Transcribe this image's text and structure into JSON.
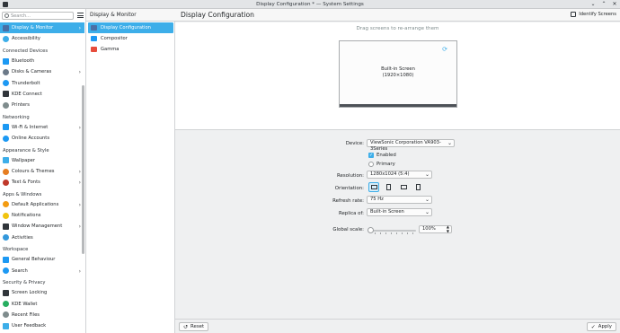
{
  "window": {
    "title": "Display Configuration * — System Settings"
  },
  "sidebar": {
    "search_placeholder": "Search...",
    "items": [
      {
        "type": "item",
        "label": "Display & Monitor",
        "icon": "monitor-icon",
        "color": "#4a6fa5",
        "active": true,
        "chevron": true
      },
      {
        "type": "item",
        "label": "Accessibility",
        "icon": "accessibility-icon",
        "color": "#3daee9"
      },
      {
        "type": "section",
        "label": "Connected Devices"
      },
      {
        "type": "item",
        "label": "Bluetooth",
        "icon": "bluetooth-icon",
        "color": "#1d99f3"
      },
      {
        "type": "item",
        "label": "Disks & Cameras",
        "icon": "disk-icon",
        "color": "#6c7a89",
        "chevron": true
      },
      {
        "type": "item",
        "label": "Thunderbolt",
        "icon": "thunderbolt-icon",
        "color": "#1d99f3"
      },
      {
        "type": "item",
        "label": "KDE Connect",
        "icon": "kde-connect-icon",
        "color": "#31363b"
      },
      {
        "type": "item",
        "label": "Printers",
        "icon": "printer-icon",
        "color": "#7f8c8d"
      },
      {
        "type": "section",
        "label": "Networking"
      },
      {
        "type": "item",
        "label": "Wi-Fi & Internet",
        "icon": "network-icon",
        "color": "#1d99f3",
        "chevron": true
      },
      {
        "type": "item",
        "label": "Online Accounts",
        "icon": "online-accounts-icon",
        "color": "#1d99f3"
      },
      {
        "type": "section",
        "label": "Appearance & Style"
      },
      {
        "type": "item",
        "label": "Wallpaper",
        "icon": "wallpaper-icon",
        "color": "#3daee9"
      },
      {
        "type": "item",
        "label": "Colours & Themes",
        "icon": "colours-icon",
        "color": "#e67e22",
        "chevron": true
      },
      {
        "type": "item",
        "label": "Text & Fonts",
        "icon": "font-icon",
        "color": "#c0392b",
        "chevron": true
      },
      {
        "type": "section",
        "label": "Apps & Windows"
      },
      {
        "type": "item",
        "label": "Default Applications",
        "icon": "default-apps-icon",
        "color": "#f39c12",
        "chevron": true
      },
      {
        "type": "item",
        "label": "Notifications",
        "icon": "bell-icon",
        "color": "#f1c40f"
      },
      {
        "type": "item",
        "label": "Window Management",
        "icon": "window-icon",
        "color": "#31363b",
        "chevron": true
      },
      {
        "type": "item",
        "label": "Activities",
        "icon": "activities-icon",
        "color": "#3498db"
      },
      {
        "type": "section",
        "label": "Workspace"
      },
      {
        "type": "item",
        "label": "General Behaviour",
        "icon": "general-behaviour-icon",
        "color": "#1d99f3"
      },
      {
        "type": "item",
        "label": "Search",
        "icon": "search-icon",
        "color": "#1d99f3",
        "chevron": true
      },
      {
        "type": "section",
        "label": "Security & Privacy"
      },
      {
        "type": "item",
        "label": "Screen Locking",
        "icon": "lock-icon",
        "color": "#31363b"
      },
      {
        "type": "item",
        "label": "KDE Wallet",
        "icon": "wallet-icon",
        "color": "#27ae60"
      },
      {
        "type": "item",
        "label": "Recent Files",
        "icon": "recent-files-icon",
        "color": "#7f8c8d"
      },
      {
        "type": "item",
        "label": "User Feedback",
        "icon": "feedback-icon",
        "color": "#3daee9"
      }
    ]
  },
  "subcategory": {
    "title": "Display & Monitor",
    "items": [
      {
        "label": "Display Configuration",
        "icon": "display-config-icon",
        "color": "#4a6fa5",
        "active": true
      },
      {
        "label": "Compositor",
        "icon": "compositor-icon",
        "color": "#1d99f3"
      },
      {
        "label": "Gamma",
        "icon": "gamma-icon",
        "color": "#e74c3c"
      }
    ]
  },
  "main": {
    "title": "Display Configuration",
    "identify_label": "Identify Screens",
    "arrange_hint": "Drag screens to re-arrange them",
    "screen": {
      "name": "Built-in Screen",
      "resolution": "(1920×1080)"
    },
    "device": {
      "label": "Device:",
      "value": "ViewSonic Corporation VA903-3Series"
    },
    "enabled": {
      "label": "Enabled",
      "checked": true
    },
    "primary": {
      "label": "Primary",
      "checked": false
    },
    "resolution": {
      "label": "Resolution:",
      "value": "1280x1024 (5:4)"
    },
    "orientation": {
      "label": "Orientation:",
      "selected": "landscape"
    },
    "refresh": {
      "label": "Refresh rate:",
      "value": "75 Hz"
    },
    "replica": {
      "label": "Replica of:",
      "value": "Built-in Screen"
    },
    "scale": {
      "label": "Global scale:",
      "value": "100%",
      "level": 0
    },
    "reset_label": "Reset",
    "apply_label": "Apply"
  },
  "colors": {
    "accent": "#3daee9",
    "sidebar_bg": "#ffffff",
    "window_bg": "#eff0f1"
  }
}
